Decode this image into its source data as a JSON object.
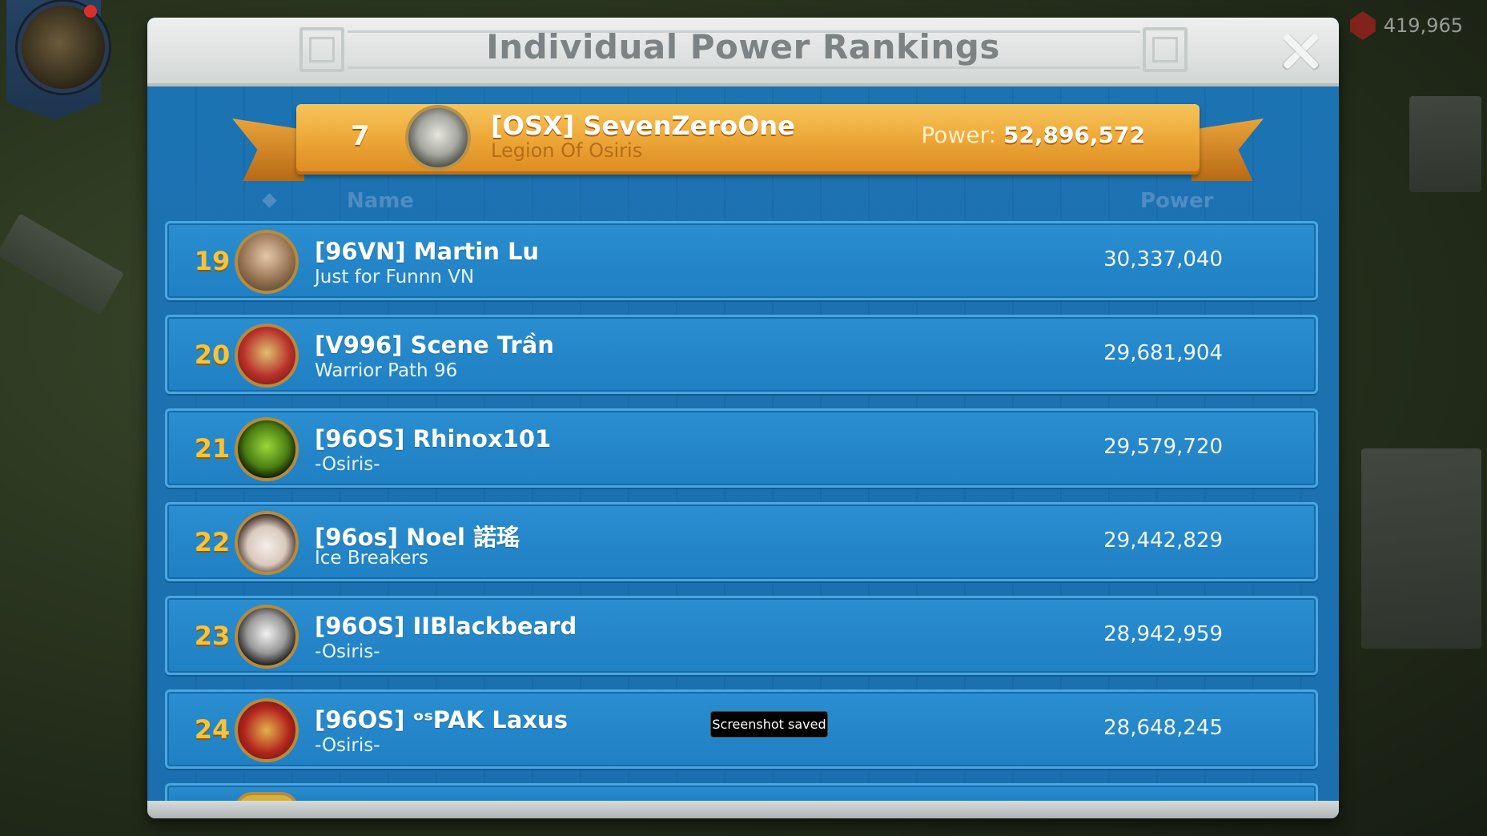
{
  "window": {
    "title": "Individual Power Rankings"
  },
  "resources": {
    "gems": "419,965"
  },
  "me": {
    "rank": "7",
    "name": "[OSX] SevenZeroOne",
    "alliance": "Legion Of Osiris",
    "power_label": "Power:",
    "power": "52,896,572"
  },
  "columns": {
    "name": "Name",
    "power": "Power"
  },
  "rankings": [
    {
      "rank": "19",
      "name": "[96VN] Martin Lu",
      "alliance": "Just for Funnn VN",
      "power": "30,337,040",
      "avatar_color": "#c9a27a"
    },
    {
      "rank": "20",
      "name": "[V996] Scene Trần",
      "alliance": "Warrior Path 96",
      "power": "29,681,904",
      "avatar_color": "#b8302a"
    },
    {
      "rank": "21",
      "name": "[96OS] Rhinox101",
      "alliance": "-Osiris-",
      "power": "29,579,720",
      "avatar_color": "#7fb81e"
    },
    {
      "rank": "22",
      "name": "[96os] Noel 諾瑤",
      "alliance": "Ice Breakers",
      "power": "29,442,829",
      "avatar_color": "#e8e2dc"
    },
    {
      "rank": "23",
      "name": "[96OS] IIBlackbeard",
      "alliance": "-Osiris-",
      "power": "28,942,959",
      "avatar_color": "#dcdcdc"
    },
    {
      "rank": "24",
      "name": "[96OS] ᵒˢPAK Laxus",
      "alliance": "-Osiris-",
      "power": "28,648,245",
      "avatar_color": "#b3261f"
    }
  ],
  "toast": {
    "text": "Screenshot saved"
  },
  "colors": {
    "panel": "#1f78b7",
    "ribbon": "#eeaa3a",
    "rank_text": "#f6c33a"
  }
}
